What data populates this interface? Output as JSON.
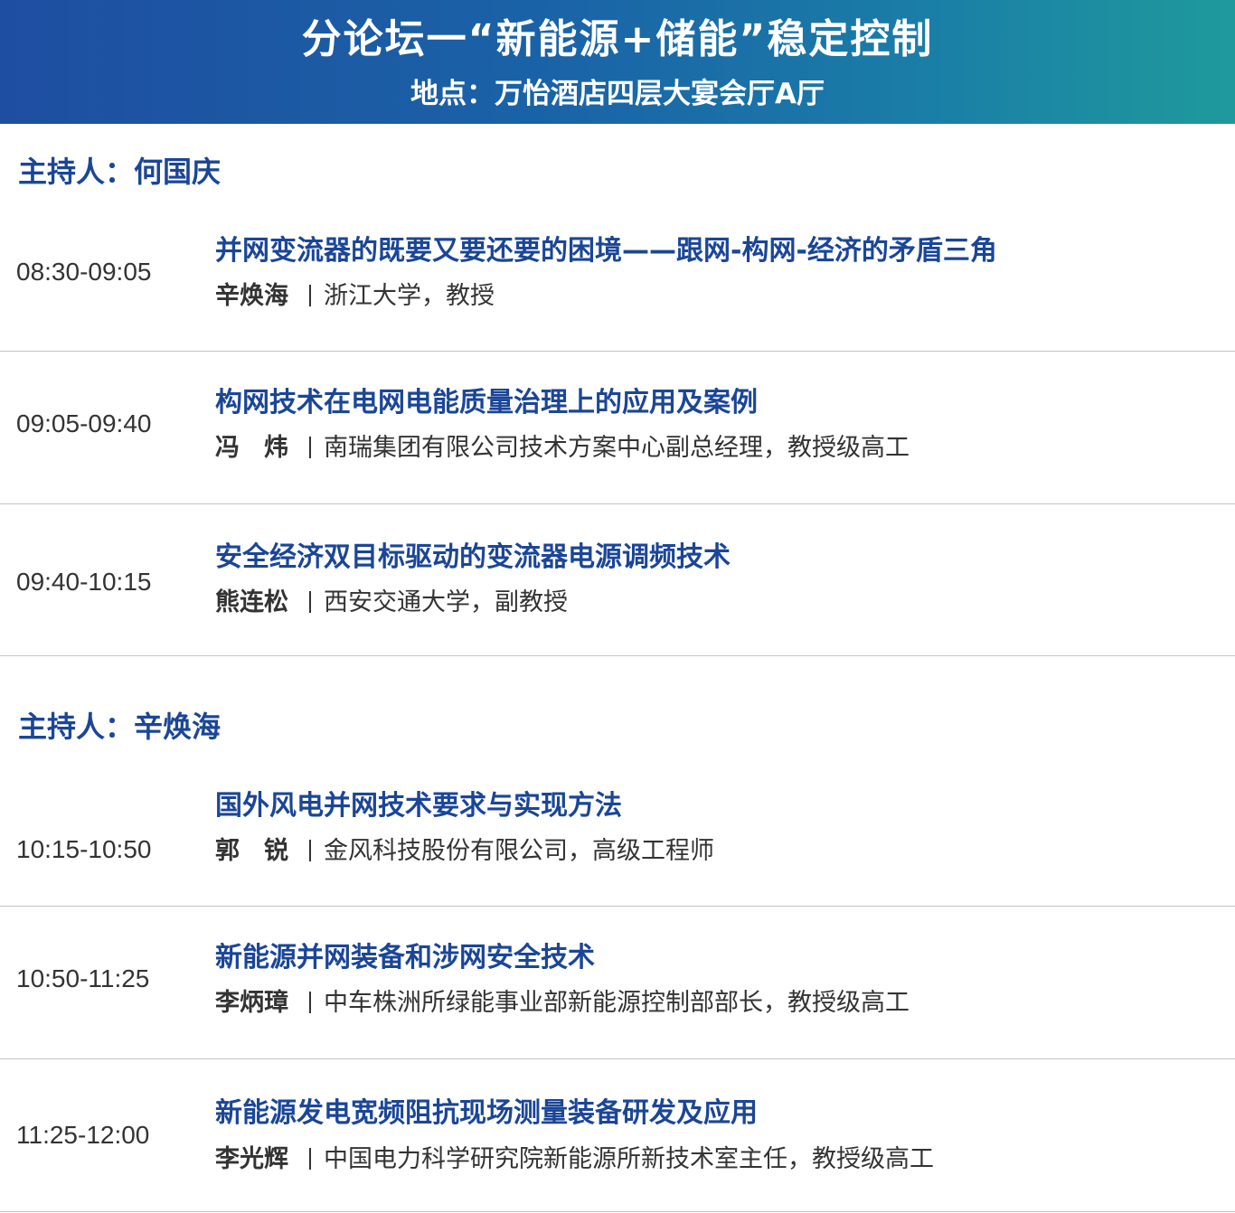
{
  "header": {
    "title": "分论坛一“新能源+储能”稳定控制",
    "venue": "地点：万怡酒店四层大宴会厅A厅"
  },
  "sessions": [
    {
      "host_label": "主持人：何国庆",
      "talks": [
        {
          "time": "08:30-09:05",
          "title": "并网变流器的既要又要还要的困境——跟网-构网-经济的矛盾三角",
          "speaker": "辛焕海",
          "affiliation": "浙江大学，教授"
        },
        {
          "time": "09:05-09:40",
          "title": "构网技术在电网电能质量治理上的应用及案例",
          "speaker": "冯　炜",
          "affiliation": "南瑞集团有限公司技术方案中心副总经理，教授级高工"
        },
        {
          "time": "09:40-10:15",
          "title": "安全经济双目标驱动的变流器电源调频技术",
          "speaker": "熊连松",
          "affiliation": "西安交通大学，副教授"
        }
      ]
    },
    {
      "host_label": "主持人：辛焕海",
      "talks": [
        {
          "time": "10:15-10:50",
          "title": "国外风电并网技术要求与实现方法",
          "speaker": "郭　锐",
          "affiliation": "金风科技股份有限公司，高级工程师"
        },
        {
          "time": "10:50-11:25",
          "title": "新能源并网装备和涉网安全技术",
          "speaker": "李炳璋",
          "affiliation": "中车株洲所绿能事业部新能源控制部部长，教授级高工"
        },
        {
          "time": "11:25-12:00",
          "title": "新能源发电宽频阻抗现场测量装备研发及应用",
          "speaker": "李光辉",
          "affiliation": "中国电力科学研究院新能源所新技术室主任，教授级高工"
        }
      ]
    }
  ]
}
